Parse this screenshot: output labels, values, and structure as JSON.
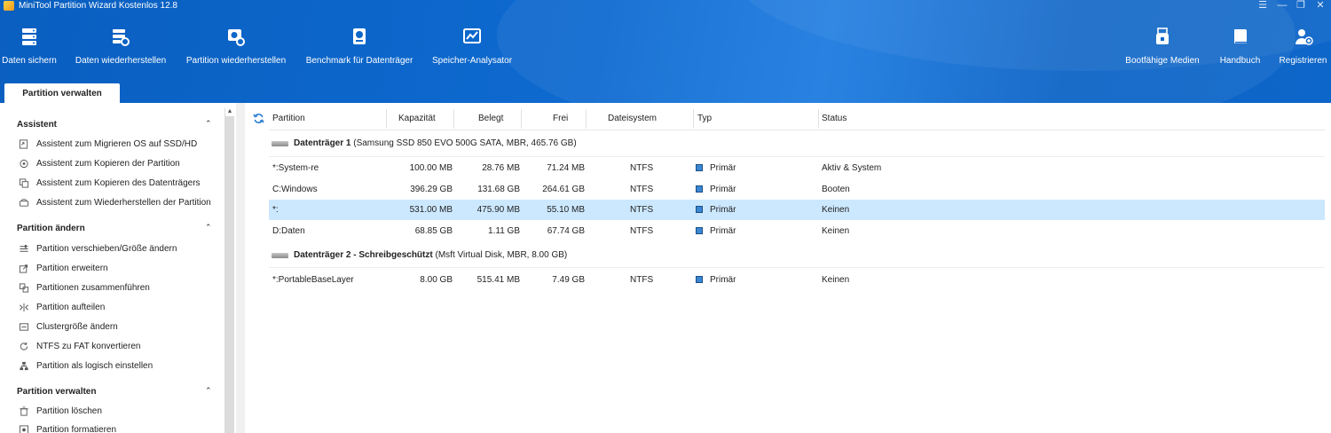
{
  "window": {
    "title": "MiniTool Partition Wizard Kostenlos 12.8",
    "controls": [
      "☰",
      "—",
      "❐",
      "✕"
    ]
  },
  "toolbar": {
    "left": [
      {
        "label": "Daten sichern",
        "icon": "backup-icon"
      },
      {
        "label": "Daten wiederherstellen",
        "icon": "data-recovery-icon"
      },
      {
        "label": "Partition wiederherstellen",
        "icon": "partition-recovery-icon"
      },
      {
        "label": "Benchmark für Datenträger",
        "icon": "disk-benchmark-icon"
      },
      {
        "label": "Speicher-Analysator",
        "icon": "space-analyzer-icon"
      }
    ],
    "right": [
      {
        "label": "Bootfähige Medien",
        "icon": "bootable-media-icon"
      },
      {
        "label": "Handbuch",
        "icon": "manual-icon"
      },
      {
        "label": "Registrieren",
        "icon": "register-icon"
      }
    ]
  },
  "tab": {
    "label": "Partition verwalten"
  },
  "sidebar": {
    "sections": [
      {
        "title": "Assistent",
        "items": [
          "Assistent zum Migrieren OS auf SSD/HD",
          "Assistent zum Kopieren der Partition",
          "Assistent zum Kopieren des Datenträgers",
          "Assistent zum Wiederherstellen der Partition"
        ]
      },
      {
        "title": "Partition ändern",
        "items": [
          "Partition verschieben/Größe ändern",
          "Partition erweitern",
          "Partitionen zusammenführen",
          "Partition aufteilen",
          "Clustergröße ändern",
          "NTFS zu FAT konvertieren",
          "Partition als logisch einstellen"
        ]
      },
      {
        "title": "Partition verwalten",
        "items": [
          "Partition löschen",
          "Partition formatieren"
        ]
      }
    ]
  },
  "table": {
    "headers": [
      "Partition",
      "Kapazität",
      "Belegt",
      "Frei",
      "Dateisystem",
      "Typ",
      "Status"
    ],
    "disks": [
      {
        "name": "Datenträger 1",
        "extra": "",
        "details": "(Samsung SSD 850 EVO 500G SATA, MBR, 465.76 GB)",
        "partitions": [
          {
            "name": "*:System-re",
            "capacity": "100.00 MB",
            "used": "28.76 MB",
            "free": "71.24 MB",
            "fs": "NTFS",
            "type": "Primär",
            "status": "Aktiv & System"
          },
          {
            "name": "C:Windows",
            "capacity": "396.29 GB",
            "used": "131.68 GB",
            "free": "264.61 GB",
            "fs": "NTFS",
            "type": "Primär",
            "status": "Booten"
          },
          {
            "name": "*:",
            "capacity": "531.00 MB",
            "used": "475.90 MB",
            "free": "55.10 MB",
            "fs": "NTFS",
            "type": "Primär",
            "status": "Keinen"
          },
          {
            "name": "D:Daten",
            "capacity": "68.85 GB",
            "used": "1.11 GB",
            "free": "67.74 GB",
            "fs": "NTFS",
            "type": "Primär",
            "status": "Keinen"
          }
        ]
      },
      {
        "name": "Datenträger 2",
        "extra": " - Schreibgeschützt",
        "details": "(Msft Virtual Disk, MBR, 8.00 GB)",
        "partitions": [
          {
            "name": "*:PortableBaseLayer",
            "capacity": "8.00 GB",
            "used": "515.41 MB",
            "free": "7.49 GB",
            "fs": "NTFS",
            "type": "Primär",
            "status": "Keinen"
          }
        ]
      }
    ]
  },
  "colors": {
    "toolbar_bg": "#0d66c9",
    "selected_row": "#cce8ff",
    "primary_square": "#3a87d4"
  }
}
